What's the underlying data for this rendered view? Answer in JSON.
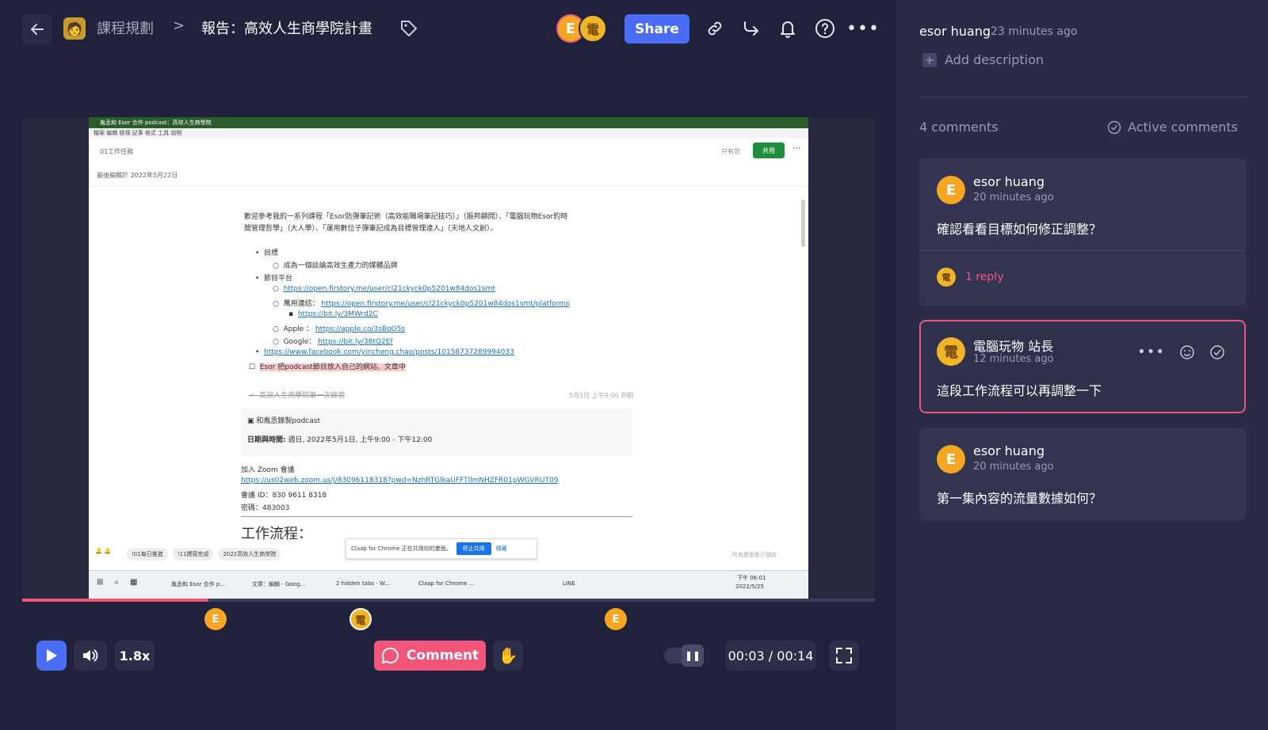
{
  "header": {
    "crumb_parent": "課程規劃",
    "crumb_separator": ">",
    "title": "報告：高效人生商學院計畫",
    "avatars": [
      "E",
      "電"
    ],
    "share_label": "Share"
  },
  "player": {
    "speed": "1.8x",
    "comment_label": "Comment",
    "time": "00:03 / 00:14",
    "progress_fraction": 0.218,
    "markers": [
      "E",
      "電",
      "E"
    ]
  },
  "screenshot": {
    "window_title": "胤丞和 Esor 合作 podcast：高效人生商學院",
    "menu": "檔案  編輯  檢視  記事  格式  工具  說明",
    "notebook": "01工作任務",
    "edited": "最後編輯於 2022年5月22日",
    "share_btn": "共用",
    "owner": "只有您",
    "intro_line1": "歡迎參考我的一系列課程「Esor防彈筆記術（高效能職場筆記技巧）」（振邦顧問）、「電腦玩物Esor的時",
    "intro_line2": "間管理哲學」（大人學）、「運用數位子彈筆記成為目標管理達人」（天地人文創）。",
    "goal": "目標",
    "goal_sub": "成為一個談論高效生產力的媒體品牌",
    "platform": "節目平台",
    "link1": "https://open.firstory.me/user/cl21ckyck0p5201w84dos1smt",
    "universal_label": "萬用連結：",
    "link2": "https://open.firstory.me/user/cl21ckyck0p5201w84dos1smt/platforms",
    "link3": "https://bit.ly/3MWrd2C",
    "apple_label": "Apple ：",
    "apple_link": "https://apple.co/3sBoO5s",
    "google_label": "Google：",
    "google_link": "https://bit.ly/38tQ2Ef",
    "fb_link": "https://www.facebook.com/yincheng.chao/posts/10158737289994033",
    "todo": "Esor 把podcast節目放入自己的網站、文章中",
    "done_task": "高效人生商學院第一次錄音",
    "done_date": "5月1日 上午9:00 到期",
    "event_title": "和胤丞錄製podcast",
    "event_time_label": "日期與時間:",
    "event_time": "週日, 2022年5月1日, 上午9:00 - 下午12:00",
    "zoom_label": "加入 Zoom 會議",
    "zoom_link": "https://us02web.zoom.us/j/83096118318?pwd=NzhRTGlkaUFFTllmNHZFR01pWGVRUT09",
    "meeting_id": "會議 ID：830 9611 8318",
    "password": "密碼：483003",
    "section": "工作流程：",
    "share_notice": "Claap for Chrome 正在共用你的畫面。",
    "stop_share": "停止共用",
    "hide": "隱藏",
    "tags": [
      "!01每日推進",
      "!11撰寫完成",
      "2022高效人生商學院"
    ],
    "saved": "所有變更都已儲存",
    "taskbar": [
      "胤丞和 Esor 合作 p...",
      "文章：編輯 - Goog...",
      "2 hidden tabs - W...",
      "Claap for Chrome ...",
      "LINE"
    ],
    "clock": "下午 06:01",
    "date": "2022/5/25"
  },
  "sidebar": {
    "author": "esor huang",
    "time": "23 minutes ago",
    "add_description": "Add description",
    "comment_count": "4 comments",
    "active_comments": "Active comments",
    "comments": [
      {
        "avatar": "E",
        "name": "esor huang",
        "time": "20 minutes ago",
        "text": "確認看看目標如何修正調整？",
        "reply_avatar": "電",
        "reply": "1 reply"
      },
      {
        "avatar": "電",
        "name": "電腦玩物 站長",
        "time": "12 minutes ago",
        "text": "這段工作流程可以再調整一下"
      },
      {
        "avatar": "E",
        "name": "esor huang",
        "time": "20 minutes ago",
        "text": "第一集內容的流量數據如何？"
      }
    ]
  },
  "colors": {
    "accent": "#f2557a",
    "share": "#4a6cf7",
    "avatar_e": "#f5a623",
    "bg": "#20213a",
    "sidebar_bg": "#2a2b45"
  }
}
